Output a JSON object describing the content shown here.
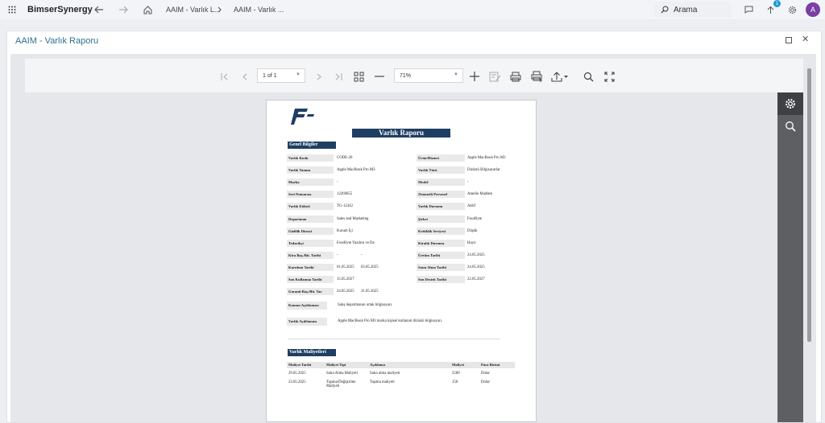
{
  "topbar": {
    "app_name": "BimserSynergy",
    "crumb1": "AAIM - Varlık L...",
    "crumb2": "AAIM - Varlık ...",
    "search_placeholder": "Arama",
    "notification_count": "1",
    "avatar_initial": "A",
    "icons": [
      "apps-grid-icon",
      "back-arrow-icon",
      "forward-arrow-icon",
      "home-icon",
      "chevron-right-icon",
      "search-icon",
      "chat-icon",
      "upload-icon",
      "gear-icon"
    ]
  },
  "window": {
    "title": "AAIM - Varlık Raporu",
    "close_glyph": "✕"
  },
  "viewer": {
    "page_label": "1 of 1",
    "zoom_label": "71%"
  },
  "report": {
    "logo_letter": "F",
    "title": "Varlık Raporu",
    "general_section": "Genel Bilgiler",
    "left_fields": [
      {
        "label": "Varlık Kodu",
        "value": "CODE-26"
      },
      {
        "label": "Varlık Tanımı",
        "value": "Apple MacBook Pro M3"
      },
      {
        "label": "Marka",
        "value": "-"
      },
      {
        "label": "Seri Numarası",
        "value": "12269655"
      },
      {
        "label": "Varlık Etiketi",
        "value": "TG-12342"
      },
      {
        "label": "Departman",
        "value": "Sales and Marketing"
      },
      {
        "label": "Gizlilik Düzeyi",
        "value": "Kurum İçi"
      },
      {
        "label": "Tedarikçi",
        "value": "FourByte Yazılım ve Da"
      },
      {
        "label": "Kira Baş./Bit. Tarihi",
        "value": "-",
        "value2": "-"
      },
      {
        "label": "Kurulum Tarihi",
        "value": "01.05.2025",
        "value2": "03.05.2025"
      },
      {
        "label": "Son Kullanma Tarihi",
        "value": "15.05.2027"
      },
      {
        "label": "Garanti Baş./Bit. Tar.",
        "value": "24.05.2025",
        "value2": "31.05.2025"
      }
    ],
    "right_fields": [
      {
        "label": "Ürün/Hizmet",
        "value": "Apple MacBook Pro M3"
      },
      {
        "label": "Varlık Türü",
        "value": "Dizüstü Bilgisayarlar"
      },
      {
        "label": "Model",
        "value": "-"
      },
      {
        "label": "Zimmetli Personel",
        "value": "Amelie Madden"
      },
      {
        "label": "Varlık Durumu",
        "value": "Aktif"
      },
      {
        "label": "Şirket",
        "value": "FourByte"
      },
      {
        "label": "Kritiklik Seviyesi",
        "value": "Düşük"
      },
      {
        "label": "Kiralık Durumu",
        "value": "Hayır"
      },
      {
        "label": "Üretim Tarihi",
        "value": "24.05.2025"
      },
      {
        "label": "Satın Alma Tarihi",
        "value": "24.05.2025"
      },
      {
        "label": "Son Destek Tarihi",
        "value": "22.05.2027"
      }
    ],
    "konum_label": "Konum Açıklaması",
    "konum_value": "Satış departmanın ortak bilgisayarı.",
    "varlik_aciklama_label": "Varlık Açıklaması",
    "varlik_aciklama_value": "Apple MacBook Pro M3 marka kişisel kullanım dizüstü bilgisayarı.",
    "cost_section": "Varlık Maliyetleri",
    "cost_headers": [
      "Maliyet Tarihi",
      "Maliyet Tipi",
      "Açıklama",
      "Maliyet",
      "Para Birimi"
    ],
    "cost_rows": [
      [
        "29.05.2025",
        "Satın Alma Maliyeti",
        "Satın alma maliyeti",
        "2500",
        "Dolar"
      ],
      [
        "23.05.2025",
        "Taşıma/Değiştirme Maliyeti",
        "Taşıma maliyeti",
        "150",
        "Dolar"
      ]
    ]
  }
}
